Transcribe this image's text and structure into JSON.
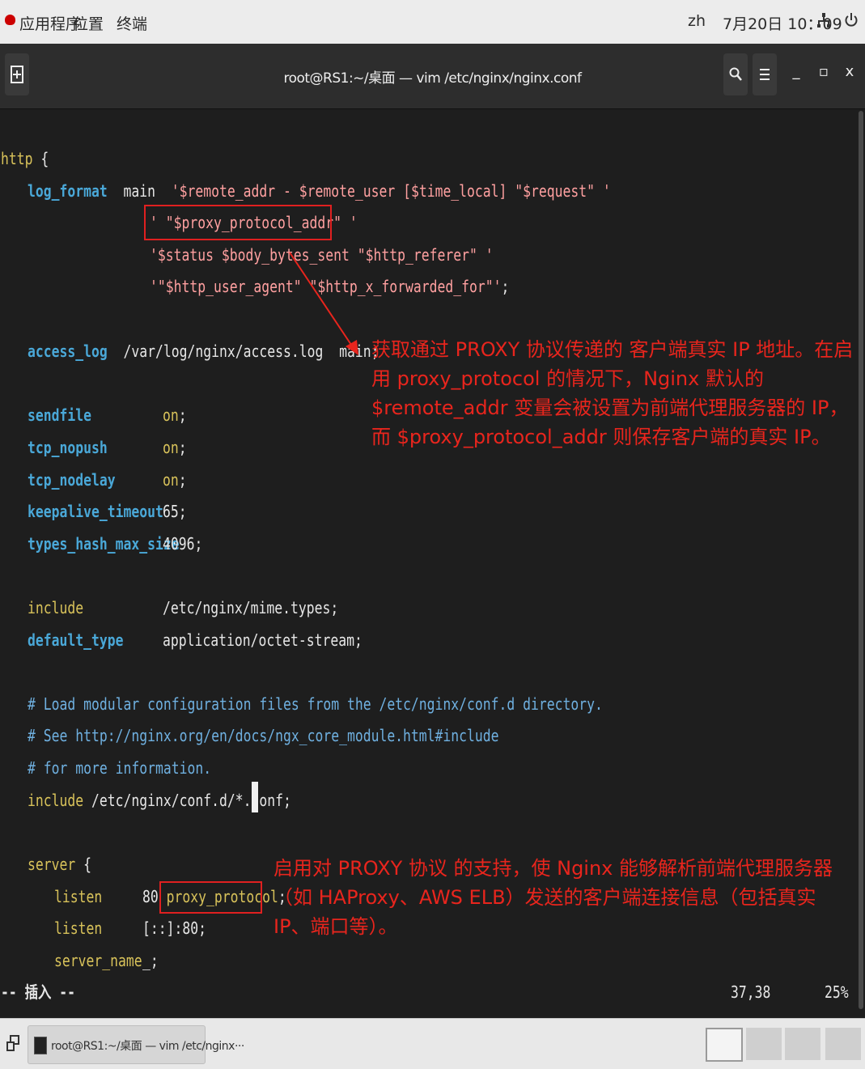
{
  "topbar": {
    "apps": "应用程序",
    "places": "位置",
    "terminal": "终端",
    "lang": "zh",
    "datetime": "7月20日 10：09",
    "network_icon": "network-icon",
    "power_icon": "power-icon"
  },
  "window": {
    "title": "root@RS1:~/桌面 — vim /etc/nginx/nginx.conf",
    "new_tab_icon": "new-tab-icon",
    "search_icon": "search-icon",
    "menu_icon": "hamburger-menu-icon",
    "minimize": "_",
    "maximize": "▫",
    "close": "x"
  },
  "code": {
    "l1_kw": "http",
    "l1_rest": " {",
    "l2_kw": "log_format",
    "l2_name": "  main  ",
    "l2_str": "'$remote_addr - $remote_user [$time_local] \"$request\" '",
    "l3_str": "' \"$proxy_protocol_addr\" '",
    "l4_str": "'$status $body_bytes_sent \"$http_referer\" '",
    "l5_str": "'\"$http_user_agent\" \"$http_x_forwarded_for\"'",
    "l5_end": ";",
    "l6_kw": "access_log",
    "l6_rest": "  /var/log/nginx/access.log  main;",
    "l7_kw": "sendfile",
    "l7_val": "on",
    "l8_kw": "tcp_nopush",
    "l8_val": "on",
    "l9_kw": "tcp_nodelay",
    "l9_val": "on",
    "l10_kw": "keepalive_timeout",
    "l10_val": "65;",
    "l11_kw": "types_hash_max_size",
    "l11_val": "4096;",
    "l12_kw": "include",
    "l12_val": "/etc/nginx/mime.types;",
    "l13_kw": "default_type",
    "l13_val": "application/octet-stream;",
    "c1": "# Load modular configuration files from the /etc/nginx/conf.d directory.",
    "c2": "# See http://nginx.org/en/docs/ngx_core_module.html#include",
    "c3": "# for more information.",
    "l14_kw": "include",
    "l14_val": " /etc/nginx/conf.d/*.conf;",
    "l15_kw": "server",
    "l15_rest": " {",
    "l16_kw": "listen",
    "l16_val": "80 ",
    "l16_pp": "proxy_protocol",
    "l16_end": ";",
    "l17_kw": "listen",
    "l17_val": "[::]:80;",
    "l18_kw": "server_name",
    "l18_val": "_;"
  },
  "status": {
    "mode": "-- 插入 --",
    "pos": "37,38",
    "pct": "25%"
  },
  "annotations": {
    "note1": "获取通过 PROXY 协议传递的 客户端真实 IP 地址。在启用 proxy_protocol 的情况下，Nginx 默认的 $remote_addr 变量会被设置为前端代理服务器的 IP，而 $proxy_protocol_addr 则保存客户端的真实 IP。",
    "note2": "启用对 PROXY 协议 的支持，使 Nginx 能够解析前端代理服务器（如 HAProxy、AWS ELB）发送的客户端连接信息（包括真实 IP、端口等）。"
  },
  "taskbar": {
    "task_label": "root@RS1:~/桌面 — vim /etc/nginx···"
  },
  "colors": {
    "annotation": "#e8251d",
    "keyword": "#4aa8d8",
    "string": "#ffa0a0",
    "value": "#d8c25a"
  }
}
